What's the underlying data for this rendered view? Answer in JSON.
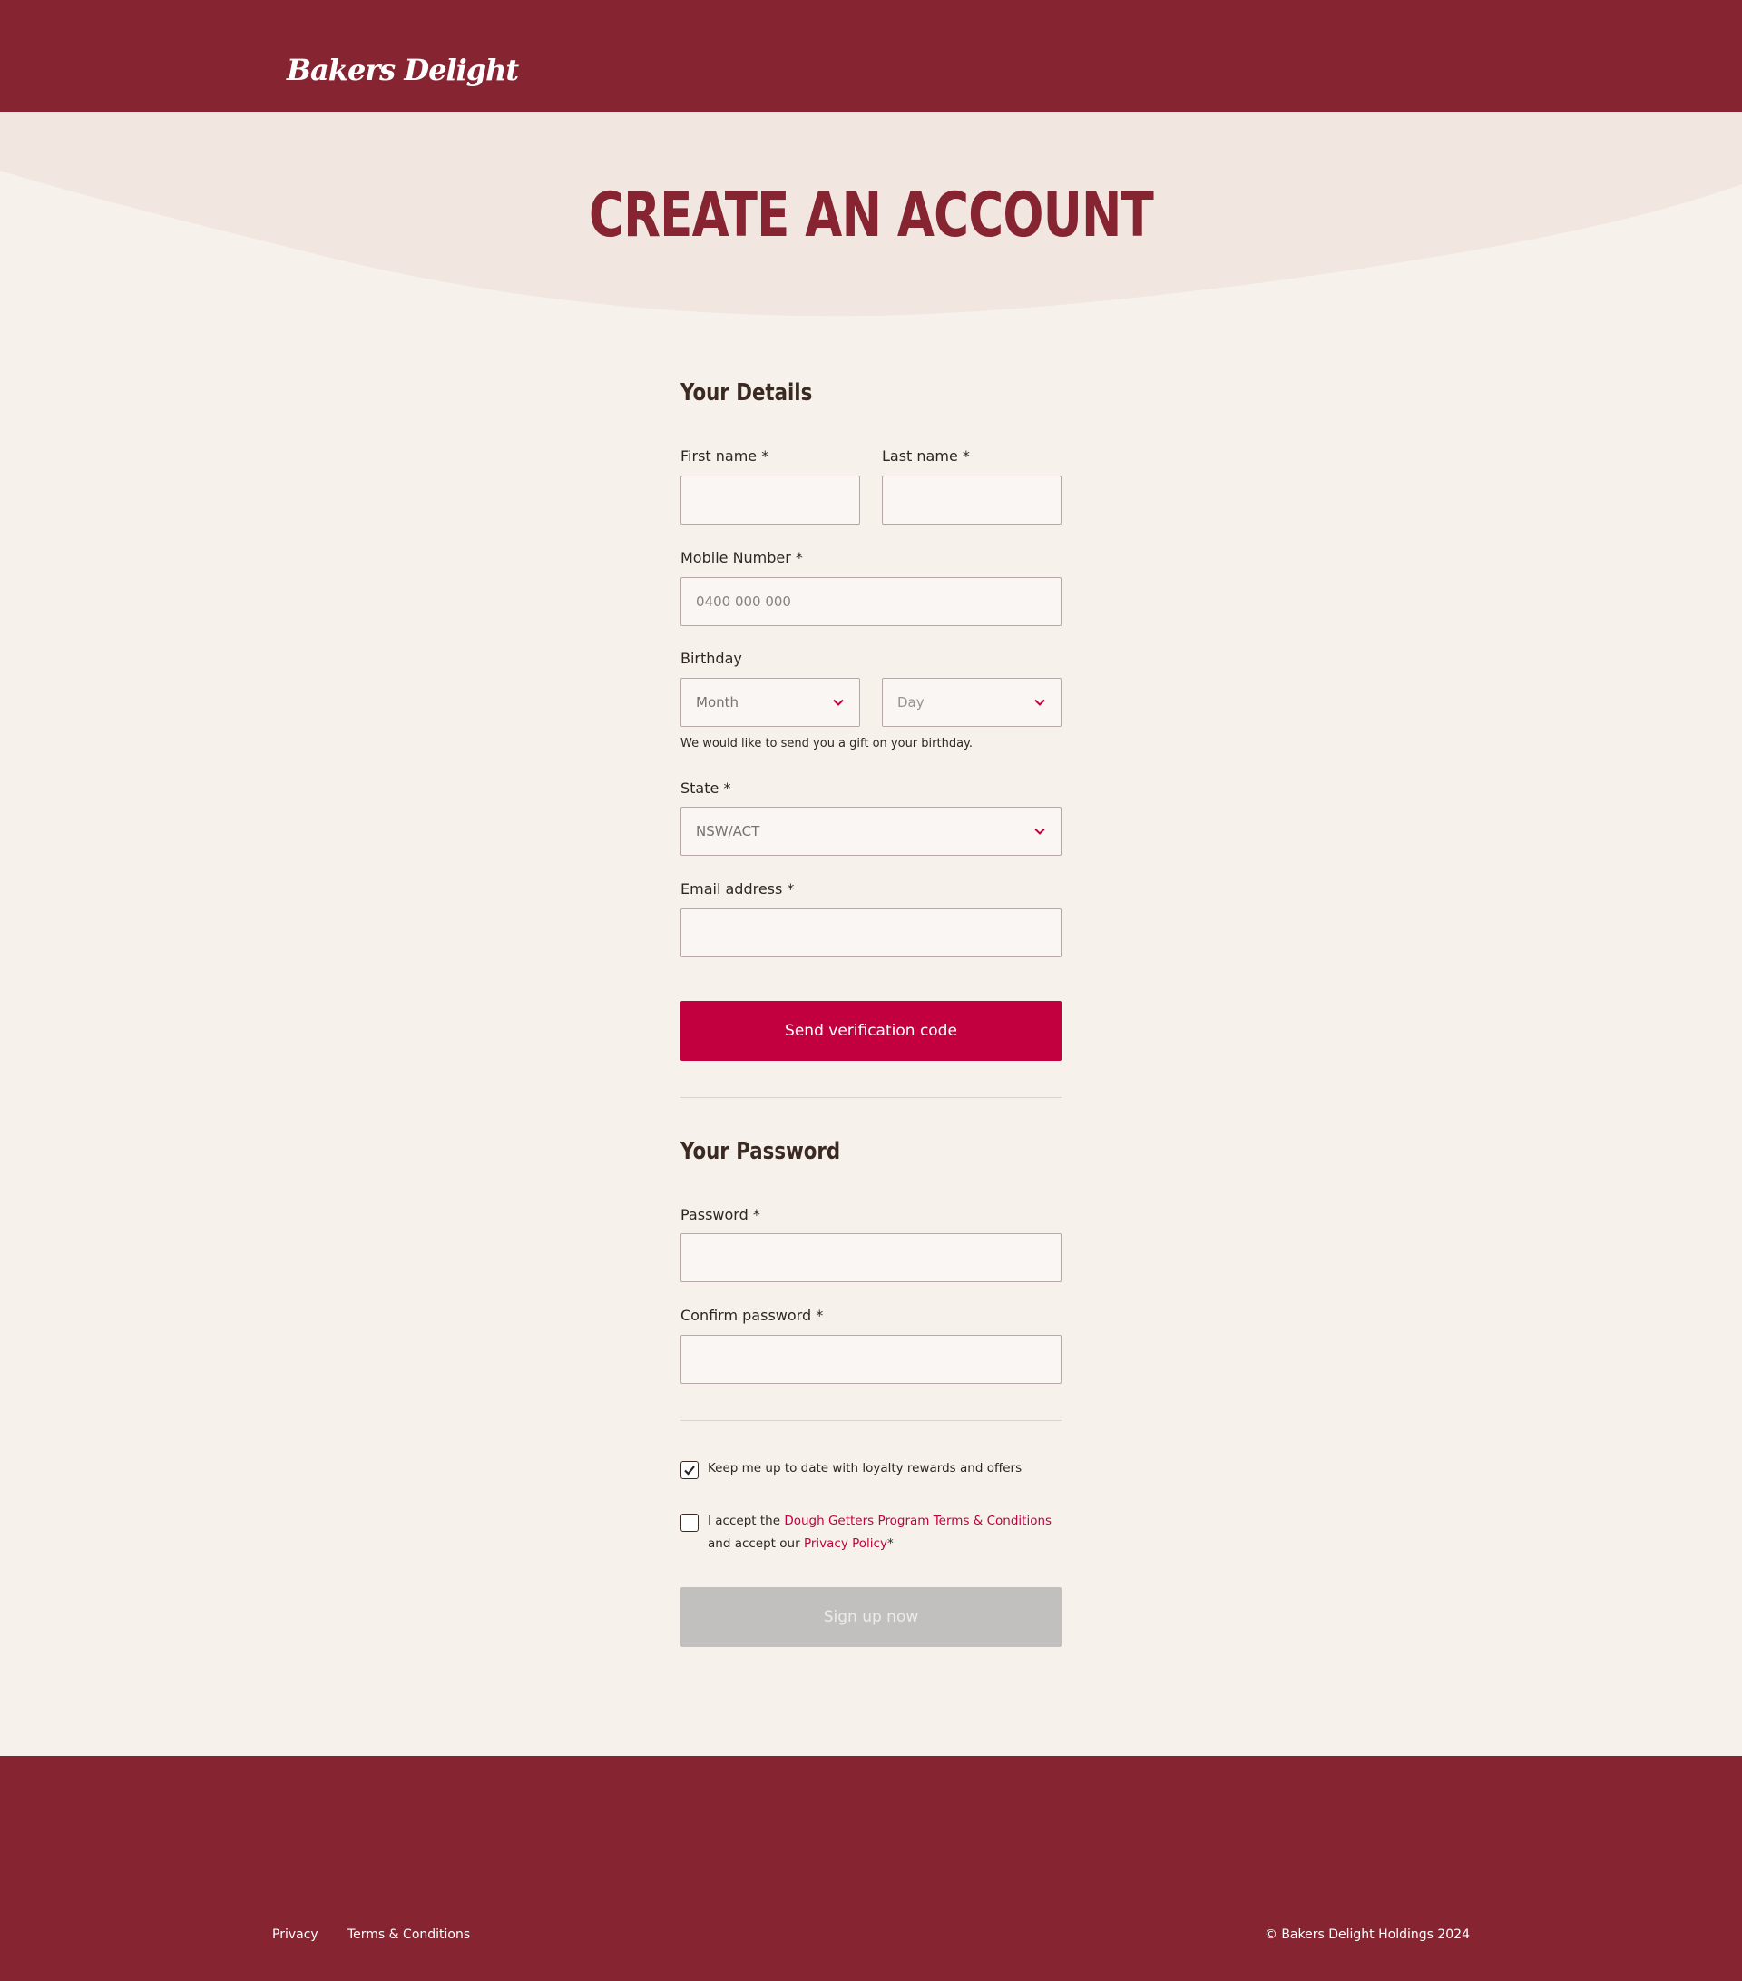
{
  "header": {
    "logo_text": "Bakers Delight"
  },
  "page": {
    "title": "CREATE AN ACCOUNT"
  },
  "details": {
    "title": "Your Details",
    "first_name_label": "First name *",
    "first_name_value": "",
    "last_name_label": "Last name *",
    "last_name_value": "",
    "mobile_label": "Mobile Number *",
    "mobile_placeholder": "0400 000 000",
    "birthday_label": "Birthday",
    "month_value": "Month",
    "day_value": "Day",
    "birthday_hint": "We would like to send you a gift on your birthday.",
    "state_label": "State *",
    "state_value": "NSW/ACT",
    "email_label": "Email address *",
    "email_value": "",
    "send_code_label": "Send verification code"
  },
  "password": {
    "title": "Your Password",
    "password_label": "Password *",
    "confirm_label": "Confirm password *"
  },
  "consent": {
    "loyalty_checked": true,
    "loyalty_text": "Keep me up to date with loyalty rewards and offers",
    "terms_checked": false,
    "terms_prefix": "I accept the",
    "terms_link": "Dough Getters Program Terms & Conditions",
    "terms_middle": "and accept our",
    "privacy_link": "Privacy Policy",
    "terms_suffix": "*"
  },
  "signup_label": "Sign up now",
  "footer": {
    "privacy": "Privacy",
    "terms": "Terms & Conditions",
    "copyright": "© Bakers Delight Holdings 2024"
  },
  "colors": {
    "brand": "#862432",
    "accent": "#c2003f",
    "background": "#f7f1ec",
    "disabled": "#c2c0bf"
  }
}
